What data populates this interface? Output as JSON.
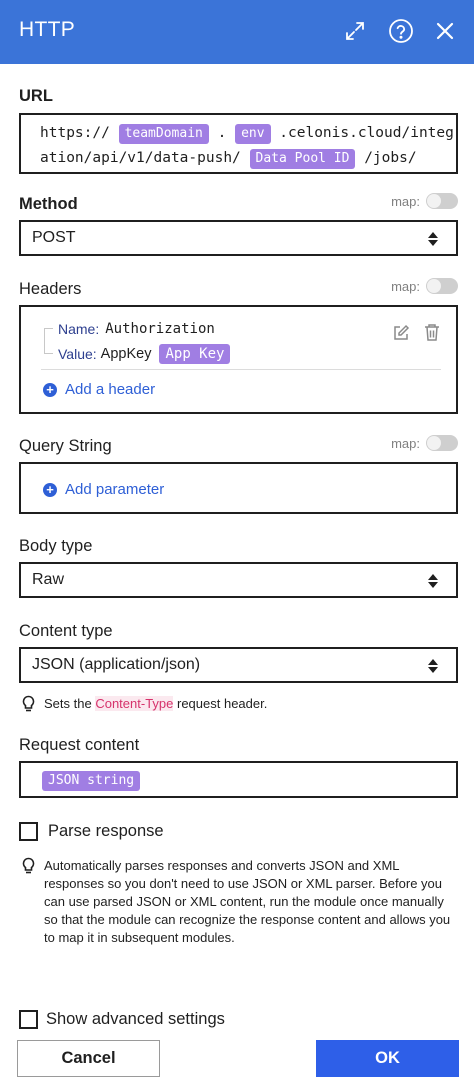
{
  "header": {
    "title": "HTTP",
    "bg_color": "#3b74d8",
    "icons": [
      "expand-icon",
      "help-icon",
      "close-icon"
    ]
  },
  "url": {
    "label": "URL",
    "line1": {
      "prefix": "https://",
      "pill1": "teamDomain",
      "dot": ".",
      "pill2": "env",
      "suffix": ".celonis.cloud/integr"
    },
    "line2": {
      "prefix": "ation/api/v1/data-push/",
      "pill": "Data Pool ID",
      "suffix": "/jobs/"
    }
  },
  "method": {
    "label": "Method",
    "map_label": "map:",
    "value": "POST"
  },
  "headers": {
    "label": "Headers",
    "map_label": "map:",
    "item": {
      "name_label": "Name:",
      "name_value": "Authorization",
      "value_label": "Value:",
      "value_text": "AppKey",
      "value_pill": "App Key"
    },
    "add_label": "Add a header"
  },
  "query": {
    "label": "Query String",
    "map_label": "map:",
    "add_label": "Add parameter"
  },
  "body_type": {
    "label": "Body type",
    "value": "Raw"
  },
  "content_type": {
    "label": "Content type",
    "value": "JSON (application/json)",
    "hint_before": "Sets the",
    "hint_highlight": "Content-Type",
    "hint_after": "request header."
  },
  "request_content": {
    "label": "Request content",
    "pill": "JSON string"
  },
  "parse_response": {
    "label": "Parse response",
    "hint": "Automatically parses responses and converts JSON and XML responses so you don't need to use JSON or XML parser. Before you can use parsed JSON or XML content, run the module once manually so that the module can recognize the response content and allows you to map it in subsequent modules."
  },
  "advanced": {
    "label": "Show advanced settings"
  },
  "footer": {
    "cancel_label": "Cancel",
    "ok_label": "OK",
    "ok_color": "#2e5fe8"
  },
  "colors": {
    "pill": "#a07ee3",
    "link": "#2e5fd6",
    "highlight": "#d6336c"
  }
}
